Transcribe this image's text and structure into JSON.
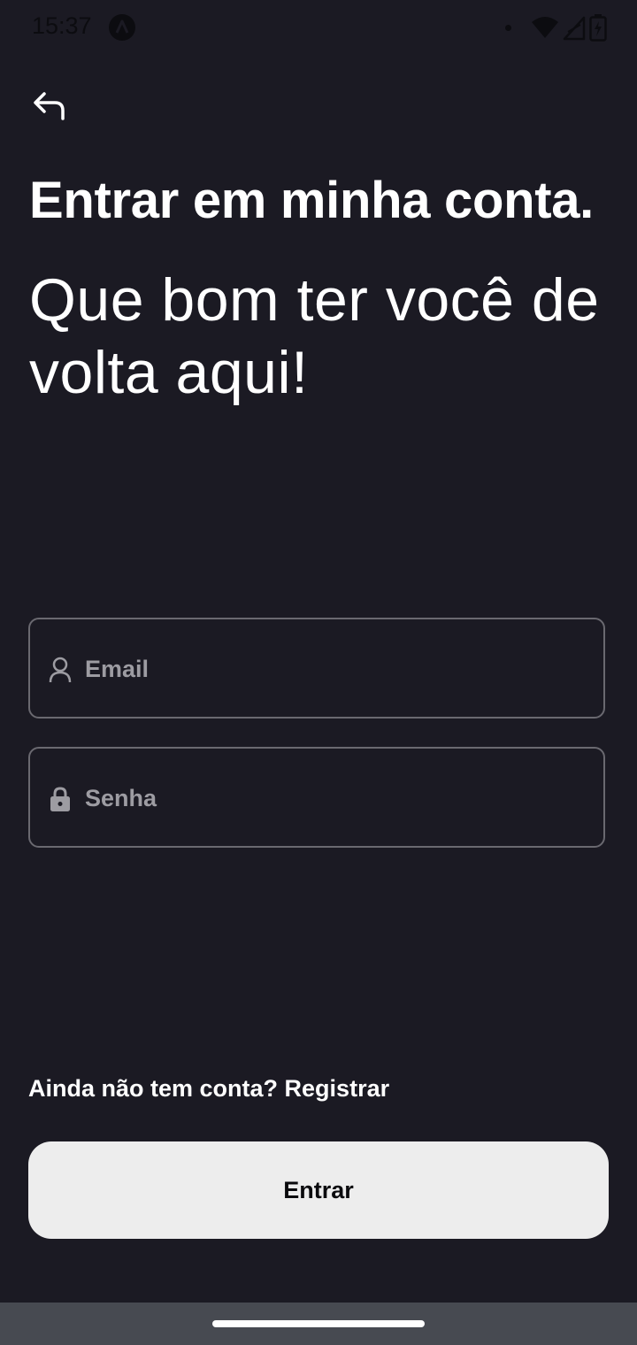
{
  "status_bar": {
    "time": "15:37",
    "icons": [
      "app-notification-icon",
      "notification-dot-icon",
      "wifi-icon",
      "signal-icon",
      "battery-charging-icon"
    ]
  },
  "header": {
    "back_icon": "back-arrow-icon",
    "title": "Entrar em minha conta.",
    "subtitle": "Que bom ter você de volta aqui!"
  },
  "form": {
    "email": {
      "placeholder": "Email",
      "value": "",
      "icon": "user-icon"
    },
    "password": {
      "placeholder": "Senha",
      "value": "",
      "icon": "lock-icon"
    }
  },
  "footer": {
    "register_prompt": "Ainda não tem conta?",
    "register_link": "Registrar",
    "login_button": "Entrar"
  },
  "colors": {
    "background": "#1b1a23",
    "field_border": "#6a6970",
    "placeholder": "#9d9ca2",
    "button_bg": "#ededed",
    "button_text": "#0b0b0e",
    "nav_bar": "#474a51"
  }
}
